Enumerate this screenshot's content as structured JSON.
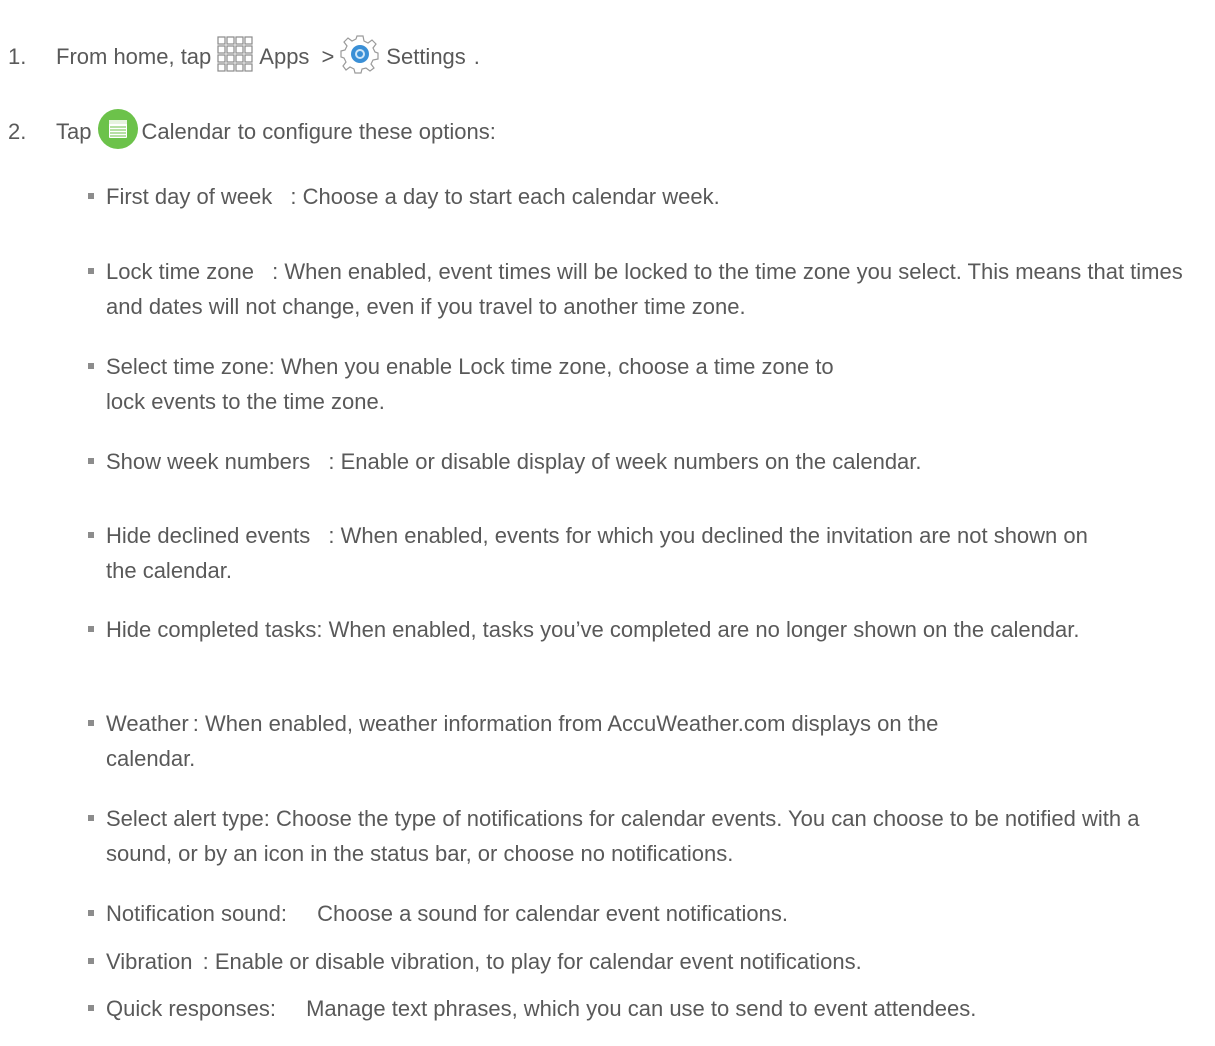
{
  "steps": [
    {
      "number": "1.",
      "text_before": "From home, tap",
      "apps_label": "Apps",
      "separator": ">",
      "settings_label": "Settings",
      "end": "."
    },
    {
      "number": "2.",
      "text_before": "Tap",
      "calendar_label": "Calendar",
      "text_after": "to configure these options:"
    }
  ],
  "options": [
    {
      "name": "First day of week",
      "sep": ":",
      "desc": "Choose a day to start each calendar week."
    },
    {
      "name": "Lock time zone",
      "sep": ":",
      "desc": "When enabled, event times will be locked to the time zone you select. This means that times and dates will not change, even if you travel to another time zone."
    },
    {
      "name": "Select time zone",
      "sep": ":",
      "desc": "When you enable Lock time zone, choose a time zone to lock events to the time zone."
    },
    {
      "name": "Show week numbers",
      "sep": ":",
      "desc": "Enable or disable display of week numbers on the calendar."
    },
    {
      "name": "Hide declined events",
      "sep": ":",
      "desc": "When enabled, events for which you declined the invitation are not shown on the calendar."
    },
    {
      "name": "Hide completed tasks",
      "sep": ":",
      "desc": "When enabled, tasks you’ve completed are no longer shown on the calendar."
    },
    {
      "name": "Weather",
      "sep": ":",
      "desc": "When enabled, weather information from AccuWeather.com displays on the calendar."
    },
    {
      "name": "Select alert type",
      "sep": ":",
      "desc": "Choose the type of notifications for calendar events. You can choose to be notified with a sound, or by an icon in the status bar, or choose no notifications."
    },
    {
      "name": "Notification sound",
      "sep": ":",
      "desc": "Choose a sound for calendar event notifications."
    },
    {
      "name": "Vibration",
      "sep": ":",
      "desc": "Enable or disable vibration, to play for calendar event notifications."
    },
    {
      "name": "Quick responses",
      "sep": ":",
      "desc": "Manage text phrases, which you can use to send to event attendees."
    }
  ],
  "icons": {
    "apps": "apps-grid-icon",
    "settings": "settings-gear-icon",
    "calendar": "calendar-icon"
  },
  "colors": {
    "text": "#595959",
    "bullet": "#8c8c8c",
    "calendar_icon": "#6cc24a",
    "settings_icon": "#3a8fd6"
  }
}
